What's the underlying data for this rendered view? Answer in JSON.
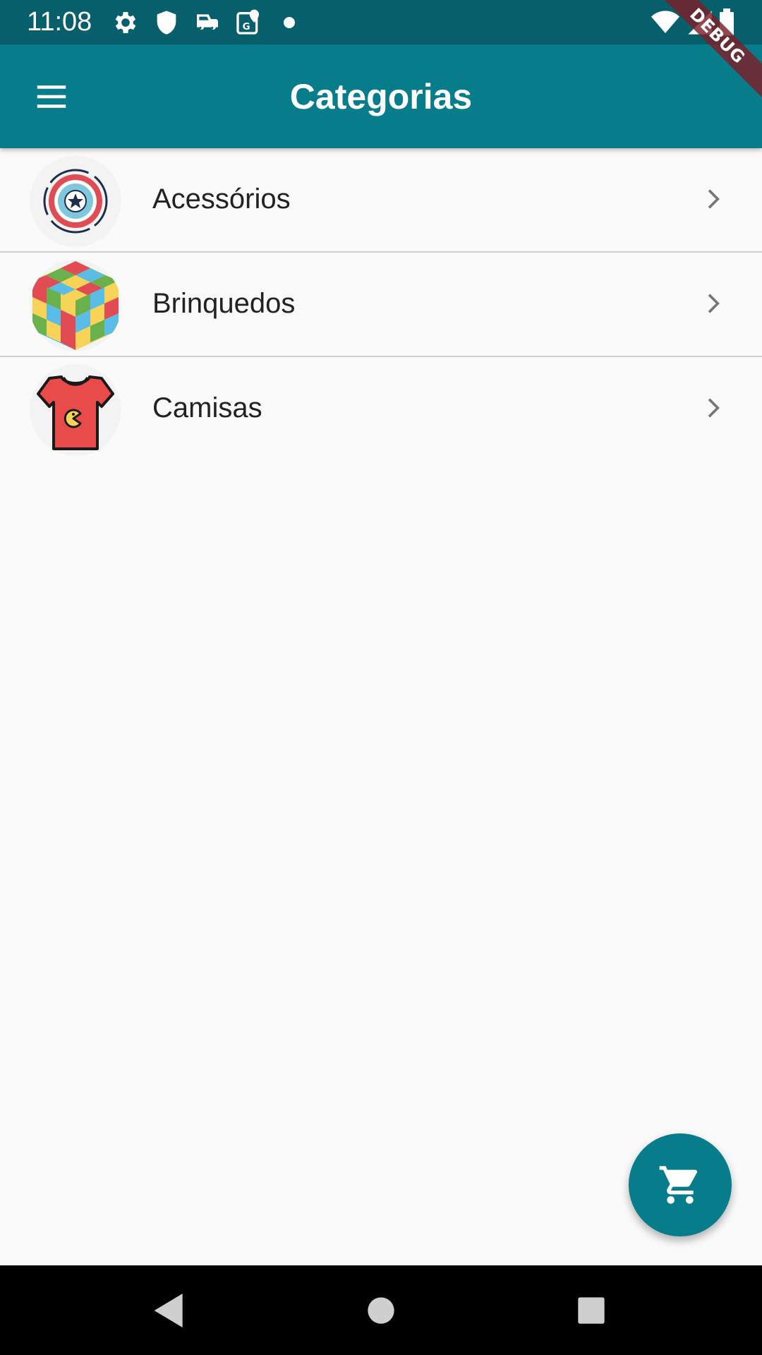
{
  "status_bar": {
    "time": "11:08",
    "icons": [
      "gear-icon",
      "shield-icon",
      "car-icon",
      "map-pin-icon",
      "dot-icon",
      "wifi-icon",
      "signal-icon",
      "battery-icon"
    ]
  },
  "app_bar": {
    "title": "Categorias",
    "menu_icon": "hamburger-menu-icon"
  },
  "debug_banner": {
    "label": "DEBUG"
  },
  "categories": [
    {
      "label": "Acessórios",
      "image": "captain-shield-image"
    },
    {
      "label": "Brinquedos",
      "image": "rubik-cube-image"
    },
    {
      "label": "Camisas",
      "image": "pacman-tshirt-image"
    }
  ],
  "fab": {
    "icon": "shopping-cart-icon"
  },
  "nav_bar": {
    "buttons": [
      "back-icon",
      "home-icon",
      "recents-icon"
    ]
  },
  "colors": {
    "primary": "#077d8b",
    "status_bar": "#075f6c",
    "background": "#fafafa",
    "divider": "#cfcfcf"
  }
}
